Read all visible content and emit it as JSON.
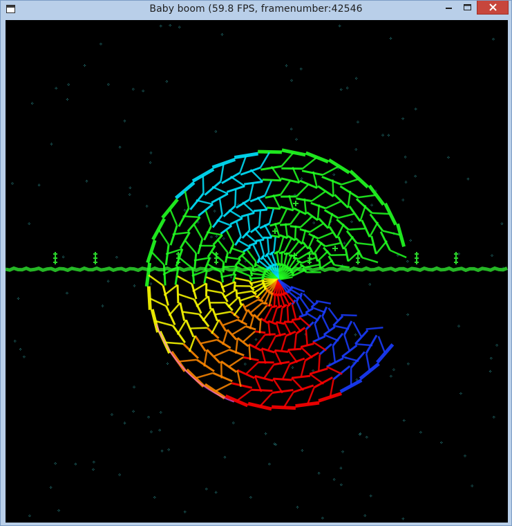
{
  "window": {
    "title": "Baby boom (59.8 FPS, framenumber:42546",
    "icon": "app-window-icon",
    "controls": {
      "minimize_icon": "minimize-icon",
      "maximize_icon": "maximize-icon",
      "close_icon": "close-icon"
    }
  },
  "scene": {
    "background_color": "#000000",
    "star_color": "#2a8a8a",
    "ground_color": "#2bd62b",
    "sphere_colors": [
      "#00e5ff",
      "#22ff22",
      "#ffff00",
      "#ff8800",
      "#ff0000",
      "#1a3cff",
      "#ff66ff"
    ]
  }
}
